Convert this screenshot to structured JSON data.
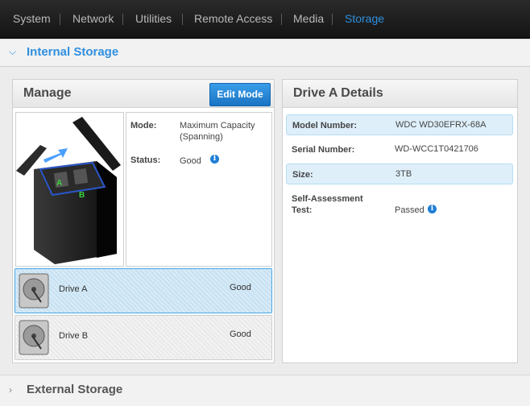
{
  "nav": {
    "items": [
      {
        "label": "System"
      },
      {
        "label": "Network"
      },
      {
        "label": "Utilities"
      },
      {
        "label": "Remote Access"
      },
      {
        "label": "Media"
      },
      {
        "label": "Storage"
      }
    ],
    "active": "Storage"
  },
  "internal": {
    "title": "Internal Storage"
  },
  "manage": {
    "title": "Manage",
    "edit_label": "Edit Mode",
    "image_labels": {
      "a": "A",
      "b": "B"
    },
    "mode_label": "Mode:",
    "mode_value_line1": "Maximum Capacity",
    "mode_value_line2": "(Spanning)",
    "status_label": "Status:",
    "status_value": "Good",
    "drives": [
      {
        "name": "Drive A",
        "status": "Good",
        "selected": true
      },
      {
        "name": "Drive B",
        "status": "Good",
        "selected": false
      }
    ]
  },
  "details": {
    "title": "Drive A Details",
    "rows": [
      {
        "label": "Model Number:",
        "value": "WDC WD30EFRX-68A"
      },
      {
        "label": "Serial Number:",
        "value": "WD-WCC1T0421706"
      },
      {
        "label": "Size:",
        "value": "3TB"
      },
      {
        "label_line1": "Self-Assessment",
        "label_line2": "Test:",
        "value": "Passed"
      }
    ]
  },
  "external": {
    "title": "External Storage"
  },
  "colors": {
    "accent": "#2f8fe0",
    "nav_bg": "#1b1b1b",
    "selected_row": "#d8ebf7"
  },
  "icons": {
    "info": "i"
  }
}
